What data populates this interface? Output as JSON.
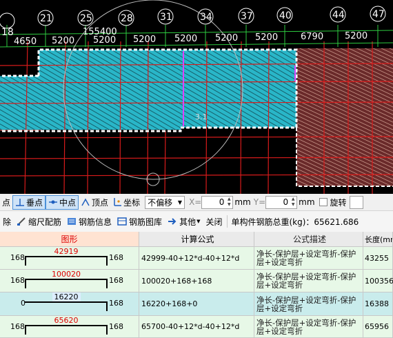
{
  "canvas": {
    "axis_numbers": [
      "18",
      "21",
      "25",
      "28",
      "31",
      "34",
      "37",
      "40",
      "44",
      "47"
    ],
    "dimensions": [
      "4650",
      "5200",
      "5200",
      "5200",
      "5200",
      "5200",
      "5200",
      "6790",
      "5200"
    ],
    "overall_dimension": "155400",
    "marker_label": "3.1"
  },
  "snapbar": {
    "items": [
      {
        "label": "点",
        "active": false
      },
      {
        "label": "垂点",
        "active": true
      },
      {
        "label": "中点",
        "active": true
      },
      {
        "label": "顶点",
        "active": false
      },
      {
        "label": "坐标",
        "active": false
      }
    ],
    "offset_select": "不偏移",
    "x_label": "X=",
    "x_value": "0",
    "x_unit": "mm",
    "y_label": "Y=",
    "y_value": "0",
    "y_unit": "mm",
    "rotate_label": "旋转"
  },
  "toolbar2": {
    "delete_label": "除",
    "scale_label": "缩尺配筋",
    "info_label": "钢筋信息",
    "library_label": "钢筋图库",
    "other_label": "其他",
    "close_label": "关闭",
    "total_label": "单构件钢筋总重(kg)：65621.686"
  },
  "table": {
    "headers": [
      "图形",
      "计算公式",
      "公式描述",
      "长度(mm)"
    ],
    "rows": [
      {
        "left": "168",
        "mid": "42919",
        "right": "168",
        "formula": "42999-40+12*d-40+12*d",
        "desc": "净长-保护层+设定弯折-保护层+设定弯折",
        "length": "43255"
      },
      {
        "left": "168",
        "mid": "100020",
        "right": "168",
        "formula": "100020+168+168",
        "desc": "净长-保护层+设定弯折-保护层+设定弯折",
        "length": "100356"
      },
      {
        "left": "0",
        "mid": "16220",
        "right": "168",
        "formula": "16220+168+0",
        "desc": "净长-保护层+设定弯折-保护层+设定弯折",
        "length": "16388"
      },
      {
        "left": "168",
        "mid": "65620",
        "right": "168",
        "formula": "65700-40+12*d-40+12*d",
        "desc": "净长-保护层+设定弯折-保护层+设定弯折",
        "length": "65956"
      }
    ]
  },
  "colors": {
    "canvas_bg": "#000000",
    "slab_fill": "#29b6c8",
    "grid_line": "#d81b1b",
    "axis_line": "#2ecc40",
    "selected_row": "#c9ecec",
    "row_bg": "#e7f8e7"
  }
}
